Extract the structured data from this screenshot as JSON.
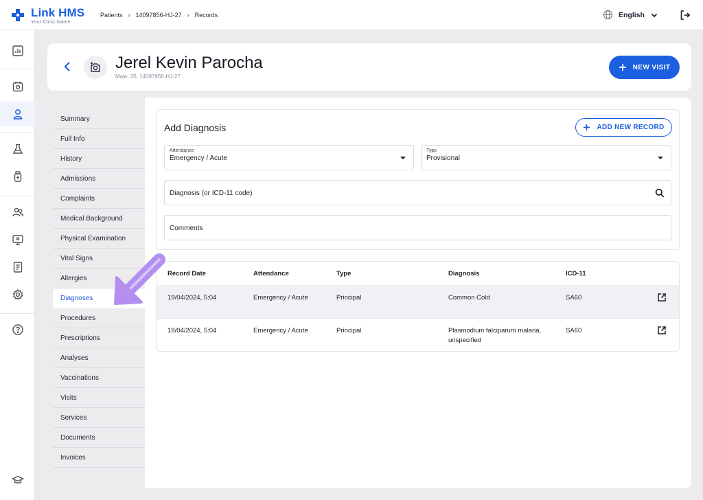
{
  "app": {
    "name": "Link HMS",
    "tagline": "Your Clinic Name",
    "accent": "#1c5fe0"
  },
  "breadcrumb": [
    "Patients",
    "14097856-HJ-27",
    "Records"
  ],
  "language": "English",
  "icons": {
    "rail": [
      "dashboard-icon",
      "calendar-icon",
      "user-icon",
      "flask-icon",
      "medicine-bottle-icon",
      "users-icon",
      "monitor-icon",
      "report-icon",
      "gear-icon",
      "help-icon",
      "graduation-cap-icon"
    ]
  },
  "patient": {
    "name": "Jerel Kevin Parocha",
    "details": "Male, 35, 14097856-HJ-27"
  },
  "header": {
    "new_visit_label": "NEW VISIT"
  },
  "subnav": {
    "items": [
      "Summary",
      "Full Info",
      "History",
      "Admissions",
      "Complaints",
      "Medical Background",
      "Physical Examination",
      "Vital Signs",
      "Allergies",
      "Diagnoses",
      "Procedures",
      "Prescriptions",
      "Analyses",
      "Vaccinations",
      "Visits",
      "Services",
      "Documents",
      "Invoices"
    ],
    "active": "Diagnoses"
  },
  "form": {
    "title": "Add Diagnosis",
    "add_record_label": "ADD NEW RECORD",
    "attendance": {
      "label": "Attendance",
      "value": "Emergency / Acute"
    },
    "type": {
      "label": "Type",
      "value": "Provisional"
    },
    "diagnosis_placeholder": "Diagnosis (or ICD-11 code)",
    "comments_placeholder": "Comments"
  },
  "table": {
    "headers": [
      "Record Date",
      "Attendance",
      "Type",
      "Diagnosis",
      "ICD-11"
    ],
    "rows": [
      {
        "date": "19/04/2024, 5:04",
        "attendance": "Emergency / Acute",
        "type": "Principal",
        "diagnosis": "Common Cold",
        "icd": "SA60"
      },
      {
        "date": "19/04/2024, 5:04",
        "attendance": "Emergency / Acute",
        "type": "Principal",
        "diagnosis": "Plasmodium falciparum malaria, unspecified",
        "icd": "SA60"
      }
    ]
  },
  "annotation": {
    "color": "#b58ff0"
  }
}
